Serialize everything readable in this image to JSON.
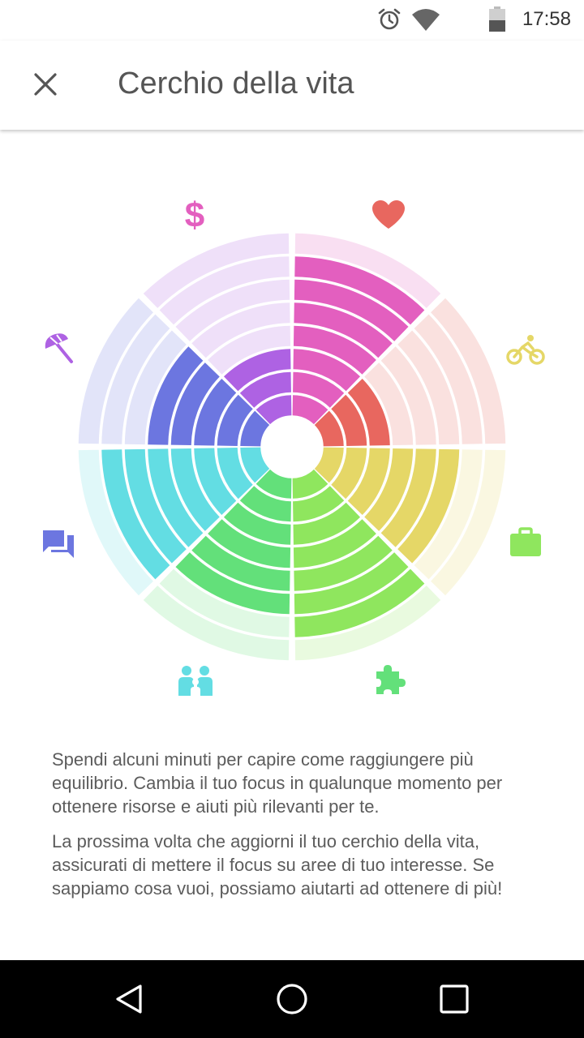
{
  "status_bar": {
    "time": "17:58",
    "icons": [
      "alarm-icon",
      "wifi-icon",
      "battery-icon"
    ]
  },
  "header": {
    "title": "Cerchio della vita",
    "close_icon": "close-icon"
  },
  "wheel": {
    "rings_total": 8,
    "areas": [
      {
        "name": "finanze",
        "icon": "dollar-icon",
        "color": "#E35FBF",
        "level": 7
      },
      {
        "name": "salute",
        "icon": "heart-icon",
        "color": "#E8675F",
        "level": 3
      },
      {
        "name": "sport",
        "icon": "bicycle-icon",
        "color": "#E5D767",
        "level": 6
      },
      {
        "name": "lavoro",
        "icon": "briefcase-icon",
        "color": "#8FE65E",
        "level": 7
      },
      {
        "name": "crescita",
        "icon": "puzzle-icon",
        "color": "#63E07A",
        "level": 6
      },
      {
        "name": "famiglia",
        "icon": "family-icon",
        "color": "#63DDE3",
        "level": 7
      },
      {
        "name": "relazioni",
        "icon": "chat-icon",
        "color": "#6C76E0",
        "level": 5
      },
      {
        "name": "tempo-libero",
        "icon": "umbrella-icon",
        "color": "#AE62E3",
        "level": 3
      }
    ]
  },
  "description": {
    "paragraph_1": "Spendi alcuni minuti per capire come raggiungere più equilibrio. Cambia il tuo focus in qualunque momento per ottenere risorse e aiuti più rilevanti per te.",
    "paragraph_2": "La prossima volta che aggiorni il tuo cerchio della vita, assicurati di mettere il focus su aree di tuo interesse. Se sappiamo cosa vuoi, possiamo aiutarti ad ottenere di più!"
  },
  "nav_bar": {
    "buttons": [
      "back-icon",
      "home-icon",
      "recents-icon"
    ]
  }
}
